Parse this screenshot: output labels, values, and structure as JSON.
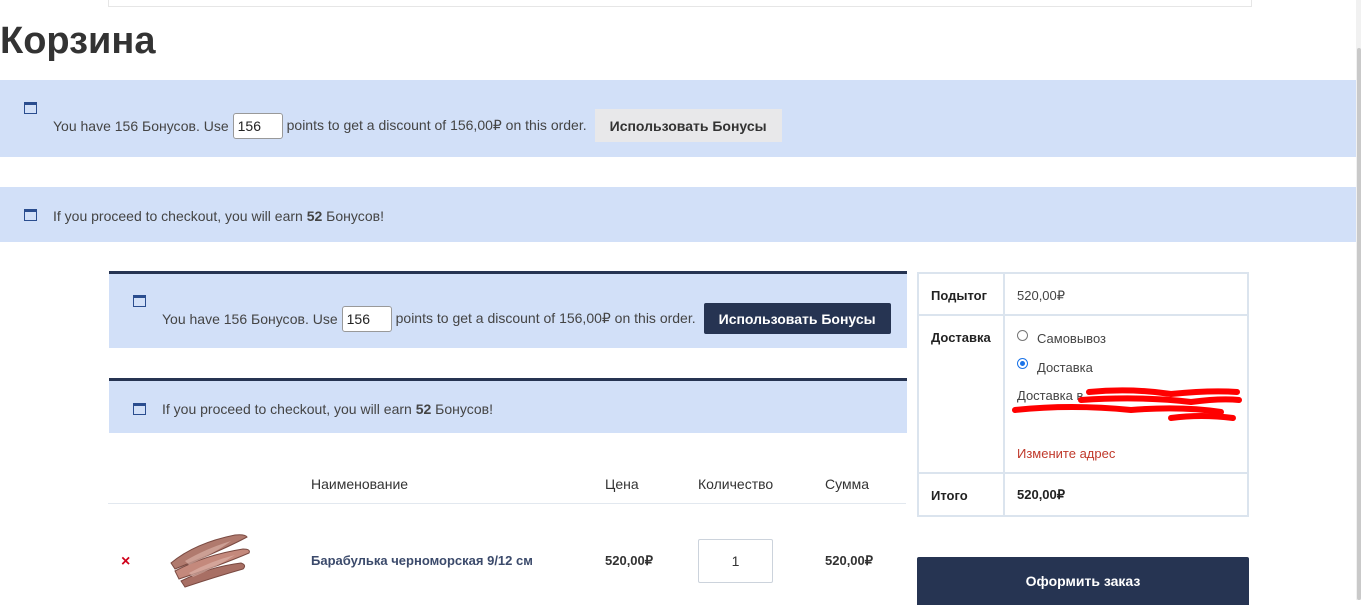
{
  "page": {
    "title": "Корзина"
  },
  "notices_outer": {
    "points": {
      "prefix": "You have 156 Бонусов. Use",
      "value": "156",
      "suffix": "points to get a discount of 156,00₽ on this order.",
      "button": "Использовать Бонусы"
    },
    "earn": {
      "prefix": "If you proceed to checkout, you will earn",
      "amount": "52",
      "suffix": "Бонусов!"
    }
  },
  "notices_inner": {
    "points": {
      "prefix": "You have 156 Бонусов. Use",
      "value": "156",
      "suffix": "points to get a discount of 156,00₽ on this order.",
      "button": "Использовать Бонусы"
    },
    "earn": {
      "prefix": "If you proceed to checkout, you will earn",
      "amount": "52",
      "suffix": "Бонусов!"
    }
  },
  "cart": {
    "headers": {
      "name": "Наименование",
      "price": "Цена",
      "qty": "Количество",
      "sum": "Сумма"
    },
    "items": [
      {
        "remove": "×",
        "name": "Барабулька черноморская 9/12 см",
        "price": "520,00₽",
        "qty": "1",
        "sum": "520,00₽"
      }
    ]
  },
  "totals": {
    "subtotal_label": "Подытог",
    "subtotal": "520,00₽",
    "shipping_label": "Доставка",
    "options": [
      "Самовывоз",
      "Доставка"
    ],
    "selected_option": "Доставка",
    "dest_prefix": "Доставка в",
    "change_address": "Измените адрес",
    "total_label": "Итого",
    "total": "520,00₽",
    "redaction_color": "#ff0000"
  },
  "checkout_button": "Оформить заказ",
  "colors": {
    "notice_bg": "#d2e0f8",
    "dark_accent": "#263452",
    "remove_red": "#d0021b",
    "link_red": "#c0392b"
  }
}
